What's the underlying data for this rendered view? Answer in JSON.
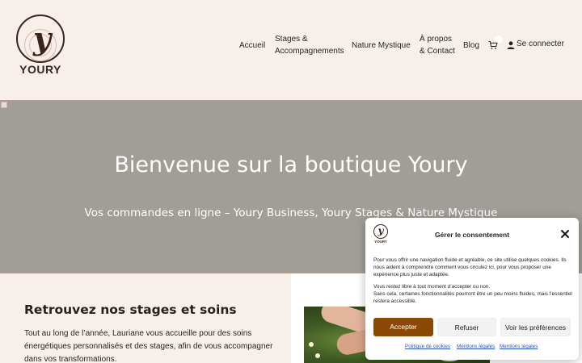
{
  "logo": {
    "monogram": "y",
    "wordmark": "YOURY"
  },
  "nav": {
    "items": [
      {
        "label": "Accueil"
      },
      {
        "label_line1": "Stages &",
        "label_line2": "Accompagnements"
      },
      {
        "label": "Nature Mystique"
      },
      {
        "label_line1": "À propos",
        "label_line2": "& Contact"
      },
      {
        "label": "Blog"
      }
    ],
    "cart_icon": "cart-icon",
    "user_icon": "user-icon",
    "login_label": "Se connecter"
  },
  "hero": {
    "title": "Bienvenue sur la boutique Youry",
    "subtitle": "Vos commandes en ligne – Youry Business, Youry Stages & Nature Mystique"
  },
  "section": {
    "title": "Retrouvez nos stages et soins",
    "text": "Tout au long de l’année, Lauriane vous accueille pour des soins énergétiques personnalisés et des stages, afin de vous accompagner dans vos transformations."
  },
  "consent": {
    "logo_wordmark": "YOURY",
    "title": "Gérer le consentement",
    "paragraph1": "Pour vous offrir une navigation fluide et agréable, ce site utilise quelques cookies. Ils nous aident à comprendre comment vous circulez ici, pour vous proposer une expérience plus juste et adaptée.",
    "paragraph2_line1": "Vous restez libre à tout moment d’accepter ou non.",
    "paragraph2_line2": "Sans cela, certaines fonctionnalités pourront être un peu moins fluides, mais l’essentiel restera accessible.",
    "accept_label": "Accepter",
    "refuse_label": "Refuser",
    "prefs_label": "Voir les préférences",
    "links": [
      "Politique de cookies",
      "Mentions légales",
      "Mentions légales"
    ]
  },
  "colors": {
    "background": "#f7efea",
    "hero": "#a09e97",
    "accent": "#8a4a05",
    "brand": "#3a2420",
    "link": "#2a53b8"
  }
}
